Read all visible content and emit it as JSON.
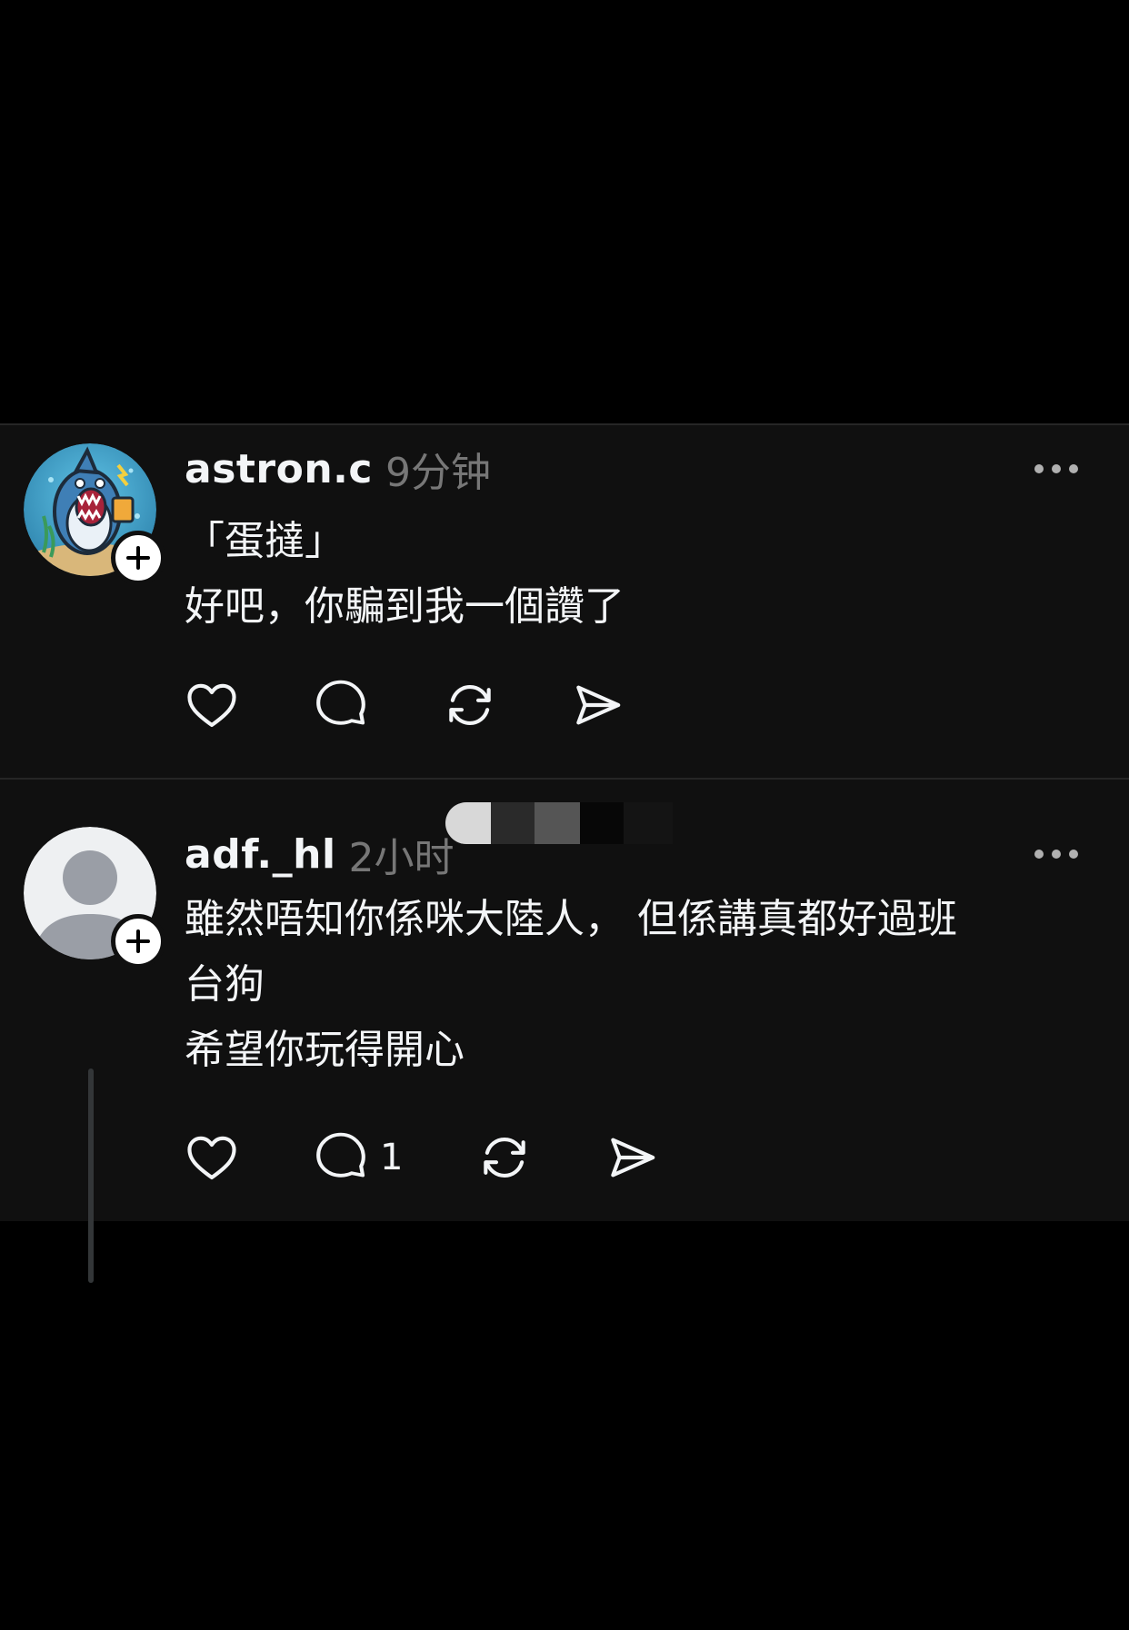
{
  "posts": [
    {
      "username": "astron.c",
      "time": "9分钟",
      "avatar_icon": "shark-avatar-icon",
      "lines": [
        "「蛋撻」",
        "好吧，你騙到我一個讚了"
      ],
      "actions": {
        "like": "",
        "reply": "",
        "repost": "",
        "share": ""
      }
    },
    {
      "username": "adf._hl",
      "time": "2小时",
      "avatar_icon": "default-person-avatar-icon",
      "lines": [
        "雖然唔知你係咪大陸人， 但係講真都好過班",
        "台狗",
        "希望你玩得開心"
      ],
      "actions": {
        "like": "",
        "reply": "1",
        "repost": "",
        "share": ""
      }
    }
  ],
  "colors": {
    "background": "#000000",
    "panel": "#101010",
    "text": "#f3f5f7",
    "muted": "#777777",
    "divider": "#262626"
  }
}
